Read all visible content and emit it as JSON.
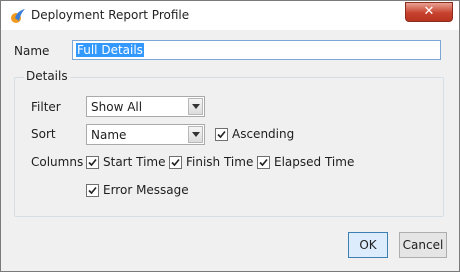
{
  "window": {
    "title": "Deployment Report Profile",
    "close_glyph": "✕"
  },
  "form": {
    "name_label": "Name",
    "name_value": "Full Details",
    "details_legend": "Details",
    "filter_label": "Filter",
    "filter_value": "Show All",
    "sort_label": "Sort",
    "sort_value": "Name",
    "ascending_label": "Ascending",
    "ascending_checked": true,
    "columns_label": "Columns",
    "columns": [
      {
        "label": "Start Time",
        "checked": true
      },
      {
        "label": "Finish Time",
        "checked": true
      },
      {
        "label": "Elapsed Time",
        "checked": true
      },
      {
        "label": "Error Message",
        "checked": true
      }
    ]
  },
  "buttons": {
    "ok": "OK",
    "cancel": "Cancel"
  },
  "colors": {
    "selection": "#3399ff",
    "close_button": "#c7432f",
    "primary_button_border": "#3c7fb1"
  },
  "icons": {
    "app": "app-logo-icon",
    "dropdown": "chevron-down-icon",
    "check": "checkmark-icon"
  }
}
